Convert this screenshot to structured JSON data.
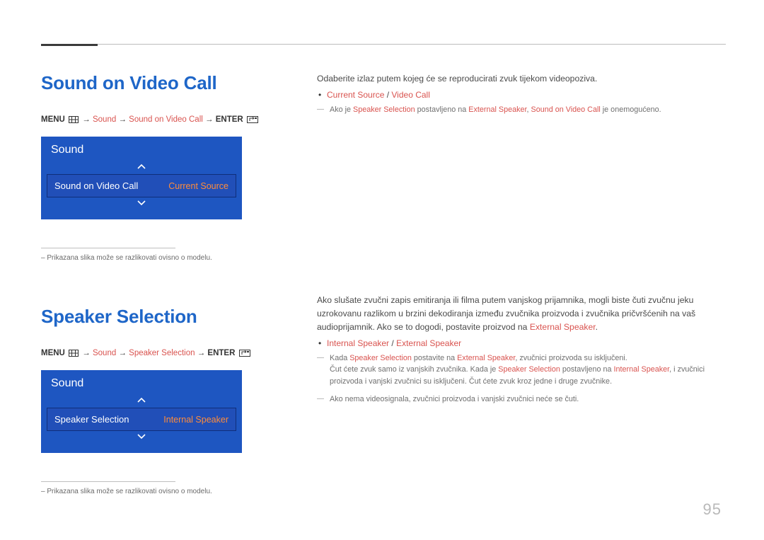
{
  "page_number": "95",
  "section1": {
    "title": "Sound on Video Call",
    "path": {
      "menu": "MENU",
      "arrow": "→",
      "seg1": "Sound",
      "seg2": "Sound on Video Call",
      "enter": "ENTER"
    },
    "osd": {
      "panel_title": "Sound",
      "row_label": "Sound on Video Call",
      "row_value": "Current Source"
    },
    "caption": "Prikazana slika može se razlikovati ovisno o modelu.",
    "right": {
      "desc": "Odaberite izlaz putem kojeg će se reproducirati zvuk tijekom videopoziva.",
      "bullet_opt1": "Current Source",
      "bullet_sep": " / ",
      "bullet_opt2": "Video Call",
      "note_pre": "Ako je ",
      "note_hl1": "Speaker Selection",
      "note_mid1": " postavljeno na ",
      "note_hl2": "External Speaker",
      "note_mid2": ", ",
      "note_hl3": "Sound on Video Call",
      "note_post": " je onemogućeno."
    }
  },
  "section2": {
    "title": "Speaker Selection",
    "path": {
      "menu": "MENU",
      "arrow": "→",
      "seg1": "Sound",
      "seg2": "Speaker Selection",
      "enter": "ENTER"
    },
    "osd": {
      "panel_title": "Sound",
      "row_label": "Speaker Selection",
      "row_value": "Internal Speaker"
    },
    "caption": "Prikazana slika može se razlikovati ovisno o modelu.",
    "right": {
      "desc_a": "Ako slušate zvučni zapis emitiranja ili filma putem vanjskog prijamnika, mogli biste čuti zvučnu jeku uzrokovanu razlikom u brzini dekodiranja između zvučnika proizvoda i zvučnika pričvršćenih na vaš audioprijamnik. Ako se to dogodi, postavite proizvod na ",
      "desc_a_hl": "External Speaker",
      "desc_a_post": ".",
      "bullet_opt1": "Internal Speaker",
      "bullet_sep": " / ",
      "bullet_opt2": "External Speaker",
      "n1_pre": "Kada ",
      "n1_hl1": "Speaker Selection",
      "n1_mid1": " postavite na ",
      "n1_hl2": "External Speaker",
      "n1_post1": ", zvučnici proizvoda su isključeni.",
      "n1_line2a": "Čut ćete zvuk samo iz vanjskih zvučnika. Kada je ",
      "n1_line2_hl1": "Speaker Selection",
      "n1_line2b": " postavljeno na ",
      "n1_line2_hl2": "Internal Speaker",
      "n1_line2c": ", i zvučnici proizvoda i vanjski zvučnici su isključeni. Čut ćete zvuk kroz jedne i druge zvučnike.",
      "n2": "Ako nema videosignala, zvučnici proizvoda i vanjski zvučnici neće se čuti."
    }
  }
}
